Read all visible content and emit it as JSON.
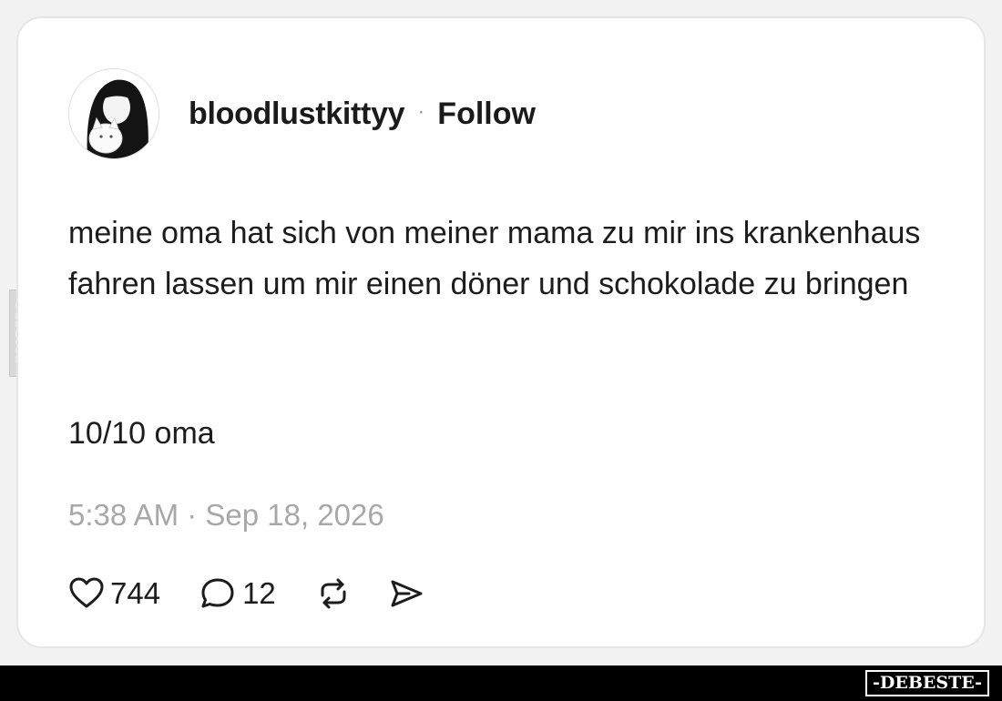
{
  "post": {
    "username": "bloodlustkittyy",
    "separator": "·",
    "follow_label": "Follow",
    "text": "meine oma hat sich von meiner mama zu mir ins krankenhaus fahren lassen um mir einen döner und schokolade zu bringen",
    "rating": "10/10 oma",
    "timestamp": "5:38 AM · Sep 18, 2026"
  },
  "actions": {
    "likes": {
      "icon": "heart-icon",
      "count": "744"
    },
    "comments": {
      "icon": "comment-icon",
      "count": "12"
    },
    "repost": {
      "icon": "repost-icon"
    },
    "share": {
      "icon": "share-icon"
    }
  },
  "watermark": {
    "footer_brand": "-DEBESTE-",
    "side_brand": "DEBESTE"
  },
  "colors": {
    "text_primary": "#1c1c1c",
    "text_muted": "#a8a8a8",
    "card_bg": "#ffffff",
    "page_bg": "#f2f2f2",
    "footer_bg": "#000000"
  }
}
